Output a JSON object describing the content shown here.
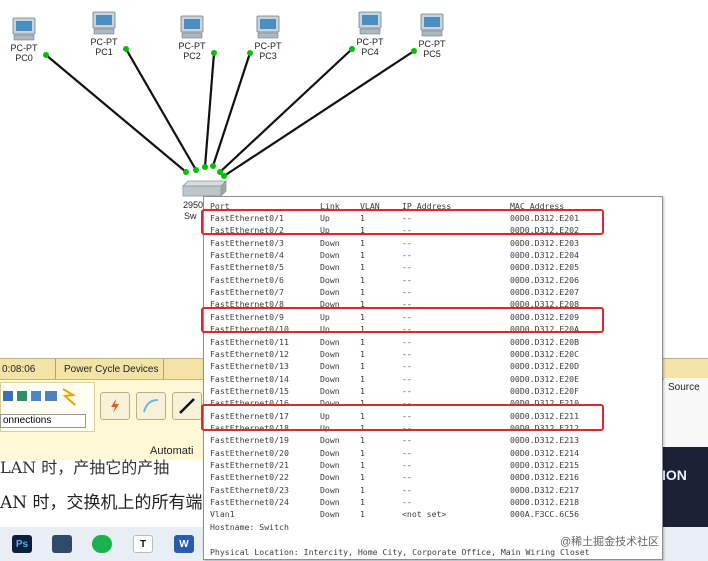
{
  "topology": {
    "pcs": [
      {
        "type": "PC-PT",
        "name": "PC0"
      },
      {
        "type": "PC-PT",
        "name": "PC1"
      },
      {
        "type": "PC-PT",
        "name": "PC2"
      },
      {
        "type": "PC-PT",
        "name": "PC3"
      },
      {
        "type": "PC-PT",
        "name": "PC4"
      },
      {
        "type": "PC-PT",
        "name": "PC5"
      }
    ],
    "switch_label_1": "2950",
    "switch_label_2": "Sw",
    "link_color": "#00c000"
  },
  "tooltip": {
    "headers": {
      "port": "Port",
      "link": "Link",
      "vlan": "VLAN",
      "ip": "IP Address",
      "mac": "MAC Address"
    },
    "rows": [
      {
        "port": "FastEthernet0/1",
        "link": "Up",
        "vlan": "1",
        "ip": "--",
        "mac": "00D0.D312.E201"
      },
      {
        "port": "FastEthernet0/2",
        "link": "Up",
        "vlan": "1",
        "ip": "--",
        "mac": "00D0.D312.E202"
      },
      {
        "port": "FastEthernet0/3",
        "link": "Down",
        "vlan": "1",
        "ip": "--",
        "mac": "00D0.D312.E203"
      },
      {
        "port": "FastEthernet0/4",
        "link": "Down",
        "vlan": "1",
        "ip": "--",
        "mac": "00D0.D312.E204"
      },
      {
        "port": "FastEthernet0/5",
        "link": "Down",
        "vlan": "1",
        "ip": "--",
        "mac": "00D0.D312.E205"
      },
      {
        "port": "FastEthernet0/6",
        "link": "Down",
        "vlan": "1",
        "ip": "--",
        "mac": "00D0.D312.E206"
      },
      {
        "port": "FastEthernet0/7",
        "link": "Down",
        "vlan": "1",
        "ip": "--",
        "mac": "00D0.D312.E207"
      },
      {
        "port": "FastEthernet0/8",
        "link": "Down",
        "vlan": "1",
        "ip": "--",
        "mac": "00D0.D312.E208"
      },
      {
        "port": "FastEthernet0/9",
        "link": "Up",
        "vlan": "1",
        "ip": "--",
        "mac": "00D0.D312.E209"
      },
      {
        "port": "FastEthernet0/10",
        "link": "Up",
        "vlan": "1",
        "ip": "--",
        "mac": "00D0.D312.E20A"
      },
      {
        "port": "FastEthernet0/11",
        "link": "Down",
        "vlan": "1",
        "ip": "--",
        "mac": "00D0.D312.E20B"
      },
      {
        "port": "FastEthernet0/12",
        "link": "Down",
        "vlan": "1",
        "ip": "--",
        "mac": "00D0.D312.E20C"
      },
      {
        "port": "FastEthernet0/13",
        "link": "Down",
        "vlan": "1",
        "ip": "--",
        "mac": "00D0.D312.E20D"
      },
      {
        "port": "FastEthernet0/14",
        "link": "Down",
        "vlan": "1",
        "ip": "--",
        "mac": "00D0.D312.E20E"
      },
      {
        "port": "FastEthernet0/15",
        "link": "Down",
        "vlan": "1",
        "ip": "--",
        "mac": "00D0.D312.E20F"
      },
      {
        "port": "FastEthernet0/16",
        "link": "Down",
        "vlan": "1",
        "ip": "--",
        "mac": "00D0.D312.E210"
      },
      {
        "port": "FastEthernet0/17",
        "link": "Up",
        "vlan": "1",
        "ip": "--",
        "mac": "00D0.D312.E211"
      },
      {
        "port": "FastEthernet0/18",
        "link": "Up",
        "vlan": "1",
        "ip": "--",
        "mac": "00D0.D312.E212"
      },
      {
        "port": "FastEthernet0/19",
        "link": "Down",
        "vlan": "1",
        "ip": "--",
        "mac": "00D0.D312.E213"
      },
      {
        "port": "FastEthernet0/20",
        "link": "Down",
        "vlan": "1",
        "ip": "--",
        "mac": "00D0.D312.E214"
      },
      {
        "port": "FastEthernet0/21",
        "link": "Down",
        "vlan": "1",
        "ip": "--",
        "mac": "00D0.D312.E215"
      },
      {
        "port": "FastEthernet0/22",
        "link": "Down",
        "vlan": "1",
        "ip": "--",
        "mac": "00D0.D312.E216"
      },
      {
        "port": "FastEthernet0/23",
        "link": "Down",
        "vlan": "1",
        "ip": "--",
        "mac": "00D0.D312.E217"
      },
      {
        "port": "FastEthernet0/24",
        "link": "Down",
        "vlan": "1",
        "ip": "--",
        "mac": "00D0.D312.E218"
      },
      {
        "port": "Vlan1",
        "link": "Down",
        "vlan": "1",
        "ip": "<not set>",
        "mac": "000A.F3CC.6C56"
      }
    ],
    "hostname": "Hostname: Switch",
    "location": "Physical Location: Intercity, Home City, Corporate Office, Main Wiring Closet",
    "highlight_color": "#e0262b"
  },
  "app": {
    "time": "0:08:06",
    "power_cycle": "Power Cycle Devices",
    "connections": "onnections",
    "automatic": "Automati",
    "source": "Source",
    "video_text": "ION"
  },
  "doc_text": {
    "line1": "LAN 时，产抽它的产抽",
    "line2": "AN 时，交换机上的所有端"
  },
  "taskbar": {
    "icons": [
      "ps-icon",
      "window-icon",
      "wechat-icon",
      "typora-icon",
      "word-icon"
    ],
    "ps_label": "Ps",
    "t_label": "T",
    "w_label": "W"
  },
  "watermark": "@稀土掘金技术社区"
}
